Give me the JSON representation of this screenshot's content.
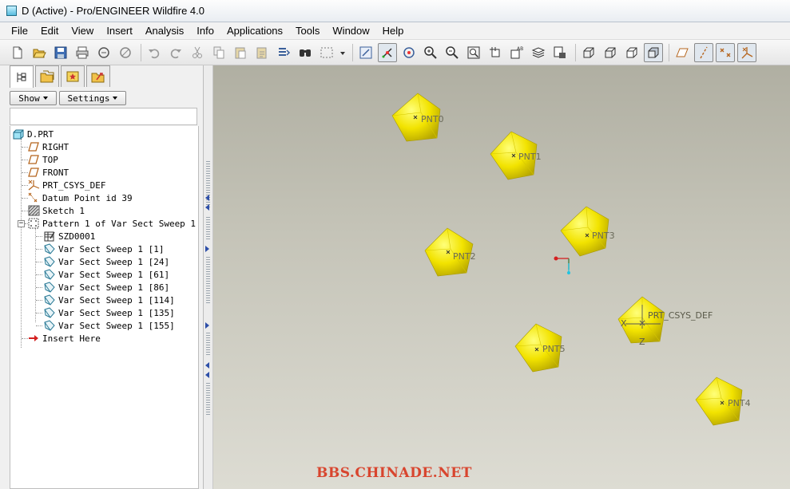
{
  "window": {
    "title": "D (Active) - Pro/ENGINEER Wildfire 4.0"
  },
  "menu": [
    "File",
    "Edit",
    "View",
    "Insert",
    "Analysis",
    "Info",
    "Applications",
    "Tools",
    "Window",
    "Help"
  ],
  "toolbar": {
    "icons": [
      "new-file-icon",
      "open-file-icon",
      "save-icon",
      "print-icon",
      "send-mail-icon",
      "send-mail-attach-icon",
      "undo-icon",
      "redo-icon",
      "cut-icon",
      "copy-icon",
      "paste-icon",
      "paste-special-icon",
      "regenerate-icon",
      "find-icon",
      "selection-box-icon",
      "redraw-icon",
      "spin-center-icon",
      "orient-mode-icon",
      "zoom-in-icon",
      "zoom-out-icon",
      "refit-icon",
      "reorient-icon",
      "saved-views-icon",
      "layers-icon",
      "view-manager-icon",
      "wireframe-icon",
      "hidden-line-icon",
      "no-hidden-icon",
      "shading-icon",
      "datum-planes-icon",
      "datum-axes-icon",
      "datum-points-icon",
      "csys-icon"
    ]
  },
  "navigator": {
    "tabs": [
      "model-tree-tab",
      "folder-browser-tab",
      "favorites-tab",
      "connections-tab"
    ],
    "show_label": "Show",
    "settings_label": "Settings",
    "tree": [
      {
        "label": "D.PRT",
        "icon": "part-icon"
      },
      {
        "label": "RIGHT",
        "icon": "datum-plane-icon"
      },
      {
        "label": "TOP",
        "icon": "datum-plane-icon"
      },
      {
        "label": "FRONT",
        "icon": "datum-plane-icon"
      },
      {
        "label": "PRT_CSYS_DEF",
        "icon": "coordinate-system-icon"
      },
      {
        "label": "Datum Point id 39",
        "icon": "datum-point-icon"
      },
      {
        "label": "Sketch 1",
        "icon": "sketch-icon"
      },
      {
        "label": "Pattern 1 of Var Sect Sweep 1",
        "icon": "pattern-icon"
      },
      {
        "label": "SZD0001",
        "icon": "pattern-table-icon"
      },
      {
        "label": "Var Sect Sweep 1 [1]",
        "icon": "sweep-icon"
      },
      {
        "label": "Var Sect Sweep 1 [24]",
        "icon": "sweep-icon"
      },
      {
        "label": "Var Sect Sweep 1 [61]",
        "icon": "sweep-icon"
      },
      {
        "label": "Var Sect Sweep 1 [86]",
        "icon": "sweep-icon"
      },
      {
        "label": "Var Sect Sweep 1 [114]",
        "icon": "sweep-icon"
      },
      {
        "label": "Var Sect Sweep 1 [135]",
        "icon": "sweep-icon"
      },
      {
        "label": "Var Sect Sweep 1 [155]",
        "icon": "sweep-icon"
      },
      {
        "label": "Insert Here",
        "icon": "insert-here-arrow-icon"
      }
    ]
  },
  "graphics": {
    "points": [
      "PNT0",
      "PNT1",
      "PNT2",
      "PNT3",
      "PNT4",
      "PNT5"
    ],
    "csys_label": "PRT_CSYS_DEF",
    "csys_axes": {
      "x": "X",
      "z": "Z"
    },
    "shape_color": "#f2e300"
  },
  "watermark": "BBS.CHINADE.NET"
}
